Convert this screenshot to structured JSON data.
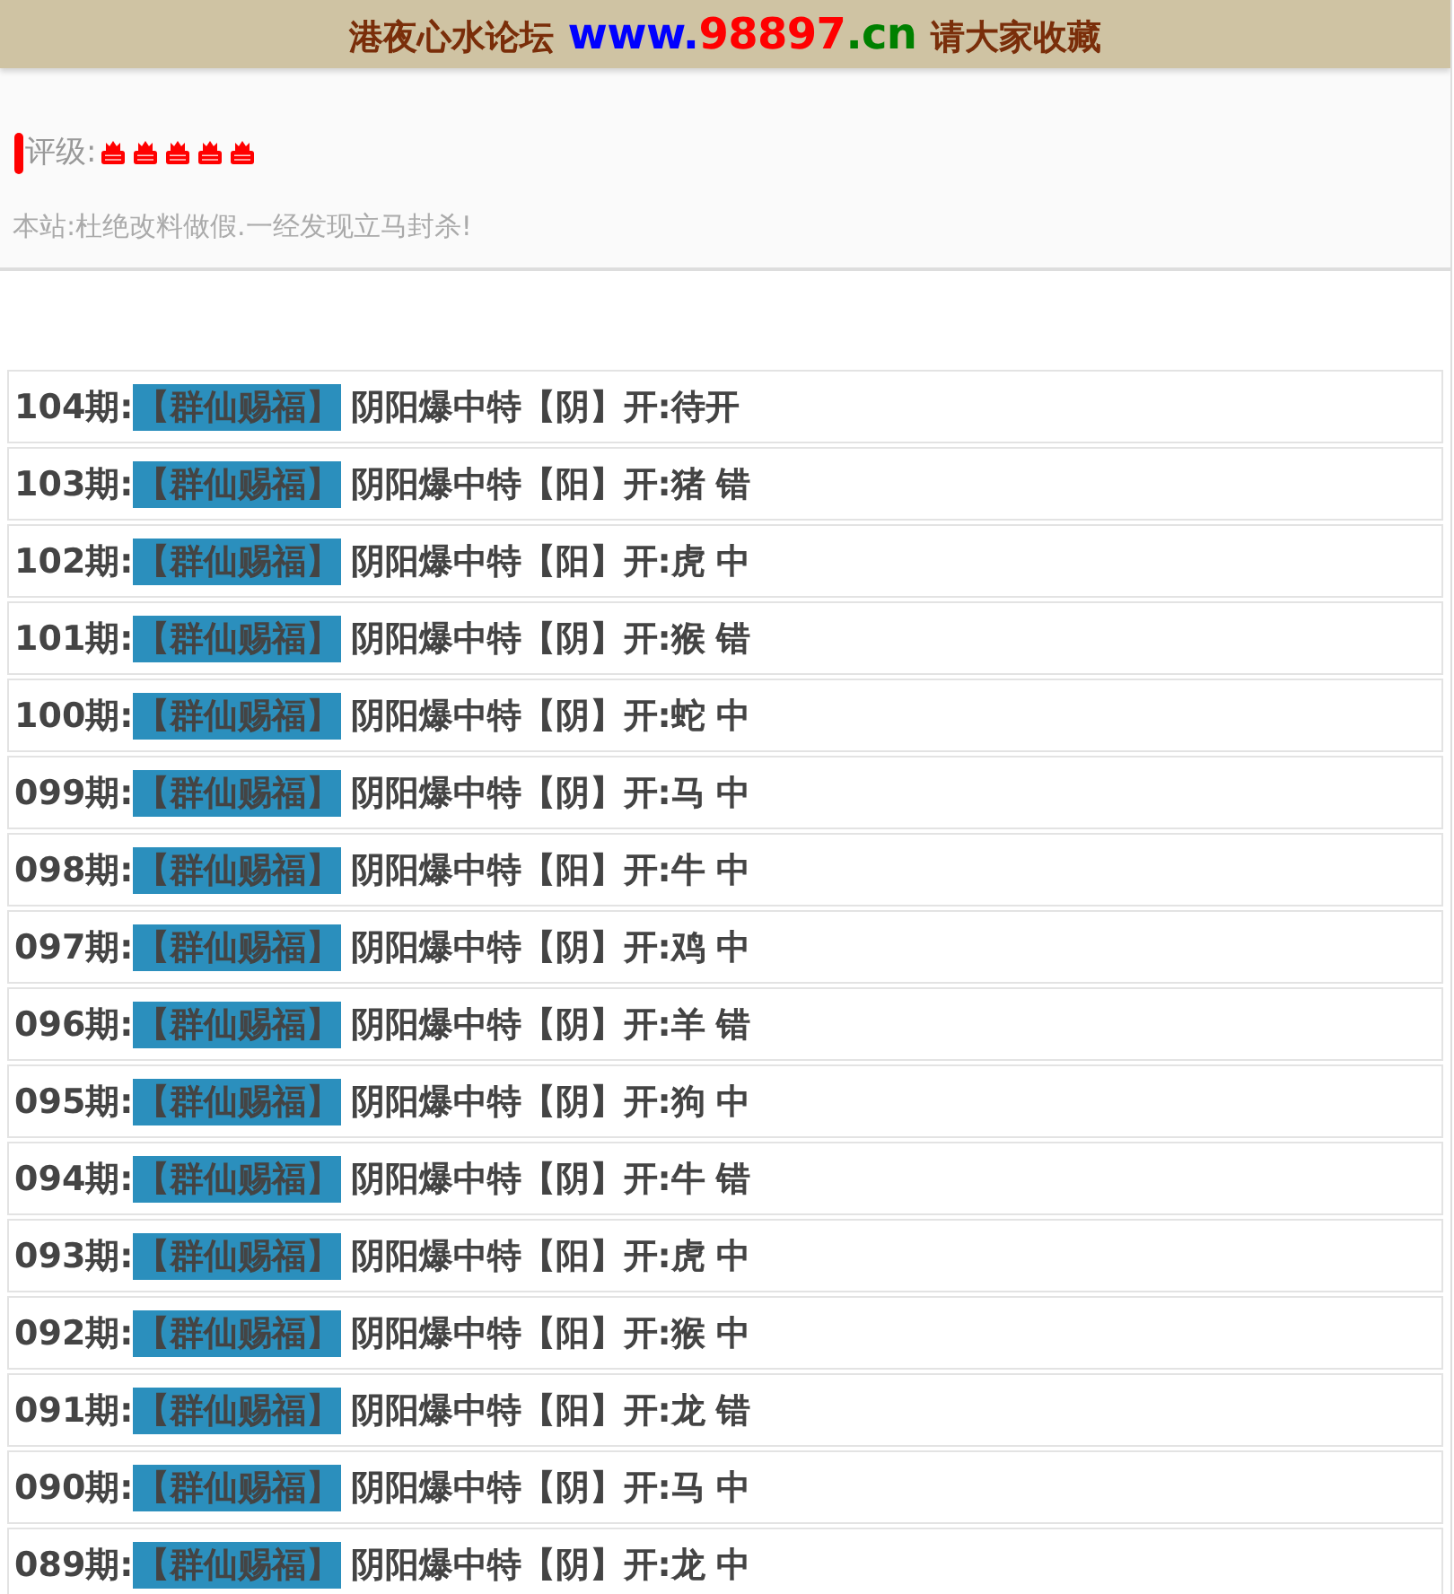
{
  "header": {
    "site_name": "港夜心水论坛",
    "url": [
      {
        "text": "www.",
        "color": "#0000ff"
      },
      {
        "text": "98897",
        "color": "#ff0000"
      },
      {
        "text": ".cn",
        "color": "#008000"
      }
    ],
    "hint": "请大家收藏"
  },
  "rating": {
    "label": "评级:",
    "stars": 5
  },
  "notice": "本站:杜绝改料做假.一经发现立马封杀!",
  "records": [
    {
      "issue": "104期:",
      "tag": "【群仙赐福】",
      "pick": "阴阳爆中特【阴】",
      "draw": "开:待开"
    },
    {
      "issue": "103期:",
      "tag": "【群仙赐福】",
      "pick": "阴阳爆中特【阳】",
      "draw": "开:猪",
      "verdict": "错"
    },
    {
      "issue": "102期:",
      "tag": "【群仙赐福】",
      "pick": "阴阳爆中特【阳】",
      "draw": "开:虎",
      "verdict": "中"
    },
    {
      "issue": "101期:",
      "tag": "【群仙赐福】",
      "pick": "阴阳爆中特【阴】",
      "draw": "开:猴",
      "verdict": "错"
    },
    {
      "issue": "100期:",
      "tag": "【群仙赐福】",
      "pick": "阴阳爆中特【阴】",
      "draw": "开:蛇",
      "verdict": "中"
    },
    {
      "issue": "099期:",
      "tag": "【群仙赐福】",
      "pick": "阴阳爆中特【阴】",
      "draw": "开:马",
      "verdict": "中"
    },
    {
      "issue": "098期:",
      "tag": "【群仙赐福】",
      "pick": "阴阳爆中特【阳】",
      "draw": "开:牛",
      "verdict": "中"
    },
    {
      "issue": "097期:",
      "tag": "【群仙赐福】",
      "pick": "阴阳爆中特【阴】",
      "draw": "开:鸡",
      "verdict": "中"
    },
    {
      "issue": "096期:",
      "tag": "【群仙赐福】",
      "pick": "阴阳爆中特【阴】",
      "draw": "开:羊",
      "verdict": "错"
    },
    {
      "issue": "095期:",
      "tag": "【群仙赐福】",
      "pick": "阴阳爆中特【阴】",
      "draw": "开:狗",
      "verdict": "中"
    },
    {
      "issue": "094期:",
      "tag": "【群仙赐福】",
      "pick": "阴阳爆中特【阴】",
      "draw": "开:牛",
      "verdict": "错"
    },
    {
      "issue": "093期:",
      "tag": "【群仙赐福】",
      "pick": "阴阳爆中特【阳】",
      "draw": "开:虎",
      "verdict": "中"
    },
    {
      "issue": "092期:",
      "tag": "【群仙赐福】",
      "pick": "阴阳爆中特【阳】",
      "draw": "开:猴",
      "verdict": "中"
    },
    {
      "issue": "091期:",
      "tag": "【群仙赐福】",
      "pick": "阴阳爆中特【阳】",
      "draw": "开:龙",
      "verdict": "错"
    },
    {
      "issue": "090期:",
      "tag": "【群仙赐福】",
      "pick": "阴阳爆中特【阴】",
      "draw": "开:马",
      "verdict": "中"
    },
    {
      "issue": "089期:",
      "tag": "【群仙赐福】",
      "pick": "阴阳爆中特【阴】",
      "draw": "开:龙",
      "verdict": "中"
    }
  ]
}
